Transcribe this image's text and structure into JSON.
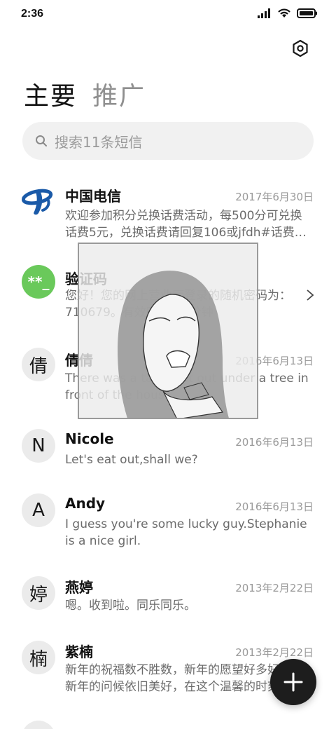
{
  "status": {
    "time": "2:36"
  },
  "tabs": {
    "primary": "主要",
    "promotions": "推广"
  },
  "search": {
    "placeholder": "搜索11条短信"
  },
  "messages": [
    {
      "sender": "中国电信",
      "date": "2017年6月30日",
      "preview": "欢迎参加积分兑换话费活动，每500分可兑换话费5元，兑换话费请回复106或jfdh#话费…",
      "avatar": "china-telecom-logo"
    },
    {
      "sender": "验证码",
      "date": "",
      "preview": "您好！您的网上营业厅登录的随机密码为：710679。有效时间为3分钟",
      "avatar": "**_"
    },
    {
      "sender": "倩倩",
      "date": "2016年6月13日",
      "preview": "There was a table set out under a tree in front of the hous",
      "avatar": "倩"
    },
    {
      "sender": "Nicole",
      "date": "2016年6月13日",
      "preview": "Let's eat out,shall we?",
      "avatar": "N"
    },
    {
      "sender": "Andy",
      "date": "2016年6月13日",
      "preview": "I guess you're some lucky guy.Stephanie is a nice girl.",
      "avatar": "A"
    },
    {
      "sender": "燕婷",
      "date": "2013年2月22日",
      "preview": "嗯。收到啦。同乐同乐。",
      "avatar": "婷"
    },
    {
      "sender": "紫楠",
      "date": "2013年2月22日",
      "preview": "新年的祝福数不胜数，新年的愿望好多好多，新年的问候依旧美好，在这个温馨的时刻",
      "avatar": "楠"
    }
  ],
  "colors": {
    "accent_green": "#6ac95b",
    "telecom_blue": "#1a5aa8",
    "fab": "#1d1d1d"
  }
}
